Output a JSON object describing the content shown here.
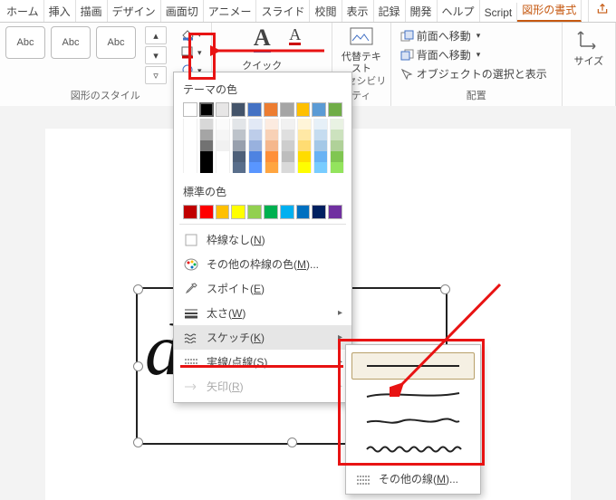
{
  "tabs": {
    "items": [
      "ホーム",
      "挿入",
      "描画",
      "デザイン",
      "画面切",
      "アニメー",
      "スライド",
      "校閲",
      "表示",
      "記録",
      "開発",
      "ヘルプ",
      "Script"
    ],
    "active": "図形の書式"
  },
  "share_icon": "share-icon",
  "ribbon": {
    "style_group_label": "図形のスタイル",
    "style_label": "Abc",
    "outline_btn_aria": "図形の枠線",
    "quick_label": "クイック",
    "font_fill": "A",
    "alt_text": "代替テキスト",
    "accessibility": "クセシビリティ",
    "arrange": {
      "bring_forward": "前面へ移動",
      "send_backward": "背面へ移動",
      "selection_pane": "オブジェクトの選択と表示",
      "group_label": "配置"
    },
    "size_label": "サイズ"
  },
  "dropdown": {
    "theme_colors_label": "テーマの色",
    "standard_colors_label": "標準の色",
    "no_outline": "枠線なし(N)",
    "more_colors": "その他の枠線の色(M)...",
    "eyedropper": "スポイト(E)",
    "weight": "太さ(W)",
    "sketch": "スケッチ(K)",
    "dashes": "実線/点線(S)",
    "arrows": "矢印(R)"
  },
  "submenu": {
    "more_lines": "その他の線(M)..."
  },
  "theme_row": [
    "#ffffff",
    "#000000",
    "#e7e6e6",
    "#44546a",
    "#4472c4",
    "#ed7d31",
    "#a5a5a5",
    "#ffc000",
    "#5b9bd5",
    "#70ad47"
  ],
  "standard_row": [
    "#c00000",
    "#ff0000",
    "#ffc000",
    "#ffff00",
    "#92d050",
    "#00b050",
    "#00b0f0",
    "#0070c0",
    "#002060",
    "#7030a0"
  ],
  "canvas_text": "de"
}
